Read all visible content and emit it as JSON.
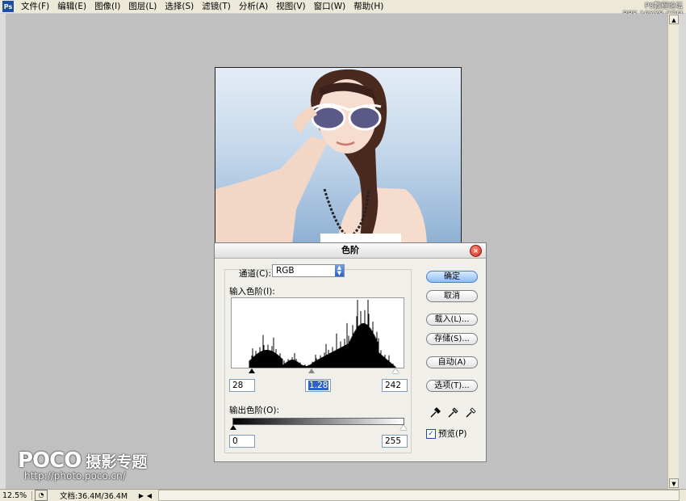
{
  "menubar": {
    "items": [
      "文件(F)",
      "编辑(E)",
      "图像(I)",
      "图层(L)",
      "选择(S)",
      "滤镜(T)",
      "分析(A)",
      "视图(V)",
      "窗口(W)",
      "帮助(H)"
    ]
  },
  "watermark_top": {
    "line1": "PS教程论坛",
    "line2": "BBS.16XX8.COM"
  },
  "logo": {
    "brand": "POCO",
    "brand_cn": "摄影专题",
    "url": "http://photo.poco.cn/"
  },
  "statusbar": {
    "zoom": "12.5%",
    "doc_size": "文档:36.4M/36.4M"
  },
  "dialog": {
    "title": "色阶",
    "channel_label": "通道(C):",
    "channel_value": "RGB",
    "input_levels_label": "输入色阶(I):",
    "input_black": "28",
    "input_gamma": "1.28",
    "input_white": "242",
    "output_levels_label": "输出色阶(O):",
    "output_black": "0",
    "output_white": "255",
    "buttons": {
      "ok": "确定",
      "cancel": "取消",
      "load": "载入(L)...",
      "save": "存储(S)...",
      "auto": "自动(A)",
      "options": "选项(T)..."
    },
    "preview_label": "预览(P)",
    "preview_checked": true
  }
}
